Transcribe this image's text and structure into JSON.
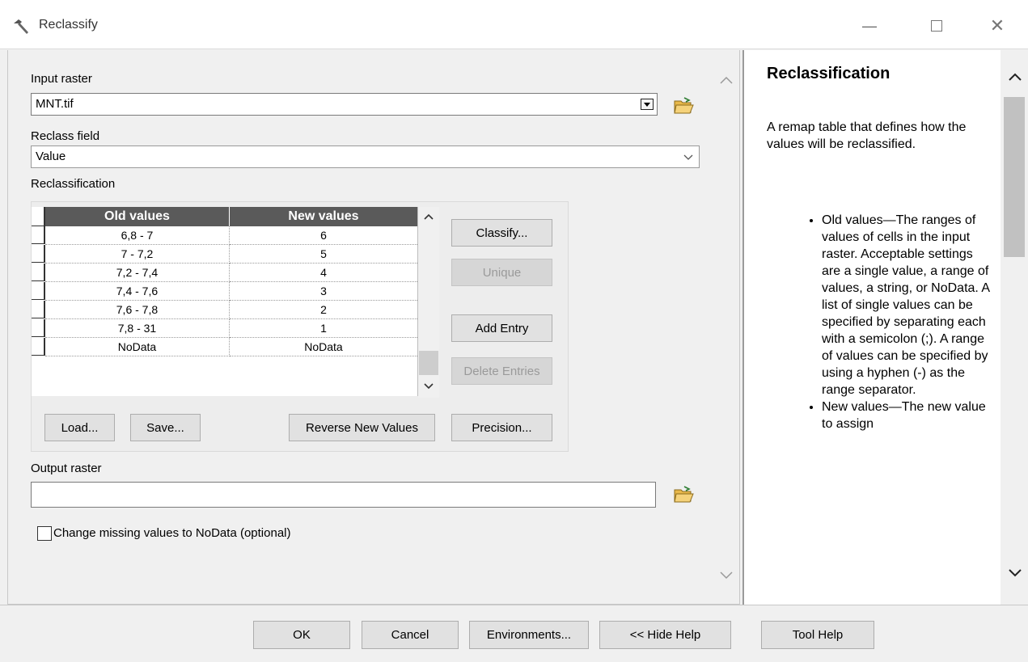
{
  "window": {
    "title": "Reclassify",
    "min_glyph": "—",
    "close_glyph": "✕"
  },
  "form": {
    "input_raster_label": "Input raster",
    "input_raster_value": "MNT.tif",
    "reclass_field_label": "Reclass field",
    "reclass_field_value": "Value",
    "reclassification_label": "Reclassification",
    "output_raster_label": "Output raster",
    "output_raster_value": "",
    "missing_checkbox_label": "Change missing values to NoData (optional)",
    "missing_checkbox_checked": false
  },
  "table": {
    "headers": [
      "Old values",
      "New values"
    ],
    "rows": [
      {
        "old": "6,8 - 7",
        "new": "6"
      },
      {
        "old": "7 - 7,2",
        "new": "5"
      },
      {
        "old": "7,2 - 7,4",
        "new": "4"
      },
      {
        "old": "7,4 - 7,6",
        "new": "3"
      },
      {
        "old": "7,6 - 7,8",
        "new": "2"
      },
      {
        "old": "7,8 - 31",
        "new": "1"
      },
      {
        "old": "NoData",
        "new": "NoData"
      }
    ]
  },
  "buttons": {
    "classify": "Classify...",
    "unique": "Unique",
    "add_entry": "Add Entry",
    "delete_entries": "Delete Entries",
    "load": "Load...",
    "save": "Save...",
    "reverse": "Reverse New Values",
    "precision": "Precision...",
    "ok": "OK",
    "cancel": "Cancel",
    "environments": "Environments...",
    "hide_help": "<< Hide Help",
    "tool_help": "Tool Help"
  },
  "help": {
    "title": "Reclassification",
    "intro": "A remap table that defines how the values will be reclassified.",
    "items": [
      "Old values—The ranges of values of cells in the input raster. Acceptable settings are a single value, a range of values, a string, or NoData. A list of single values can be specified by separating each with a semicolon (;). A range of values can be specified by using a hyphen (-) as the range separator.",
      "New values—The new value to assign"
    ]
  },
  "icons": {
    "app": "hammer-icon",
    "folder": "open-folder-icon",
    "chevron_up": "chevron-up-icon",
    "chevron_down": "chevron-down-icon"
  }
}
